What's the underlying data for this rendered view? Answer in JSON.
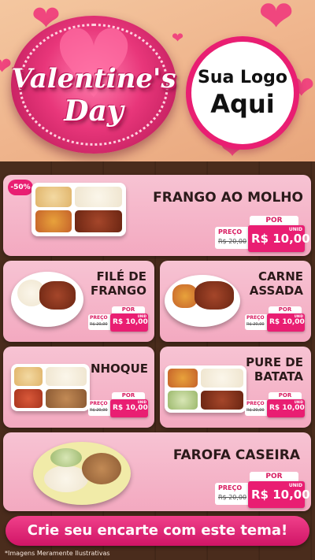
{
  "header": {
    "brand_line1": "Valentine's",
    "brand_line2": "Day",
    "logo_line1": "Sua Logo",
    "logo_line2": "Aqui"
  },
  "products": [
    {
      "name": "FRANGO AO MOLHO",
      "discount": "-50%",
      "por": "POR",
      "preco_label": "PREÇO",
      "old_price": "R$ 20,00",
      "new_price": "R$ 10,00",
      "unit": "UNID"
    },
    {
      "name_line1": "FILÉ DE",
      "name_line2": "FRANGO",
      "por": "POR",
      "preco_label": "PREÇO",
      "old_price": "R$ 20,00",
      "new_price": "R$ 10,00",
      "unit": "UNID"
    },
    {
      "name_line1": "CARNE",
      "name_line2": "ASSADA",
      "por": "POR",
      "preco_label": "PREÇO",
      "old_price": "R$ 20,00",
      "new_price": "R$ 10,00",
      "unit": "UNID"
    },
    {
      "name": "NHOQUE",
      "por": "POR",
      "preco_label": "PREÇO",
      "old_price": "R$ 20,00",
      "new_price": "R$ 10,00",
      "unit": "UNID"
    },
    {
      "name_line1": "PURE DE",
      "name_line2": "BATATA",
      "por": "POR",
      "preco_label": "PREÇO",
      "old_price": "R$ 20,00",
      "new_price": "R$ 10,00",
      "unit": "UNID"
    },
    {
      "name": "FAROFA CASEIRA",
      "por": "POR",
      "preco_label": "PREÇO",
      "old_price": "R$ 20,00",
      "new_price": "R$ 10,00",
      "unit": "UNID"
    }
  ],
  "cta": "Crie seu encarte com este tema!",
  "footnote": "*Imagens Meramente Ilustrativas",
  "colors": {
    "accent": "#e91e72",
    "card": "#f5b6c9",
    "wood": "#4a2c1c"
  }
}
